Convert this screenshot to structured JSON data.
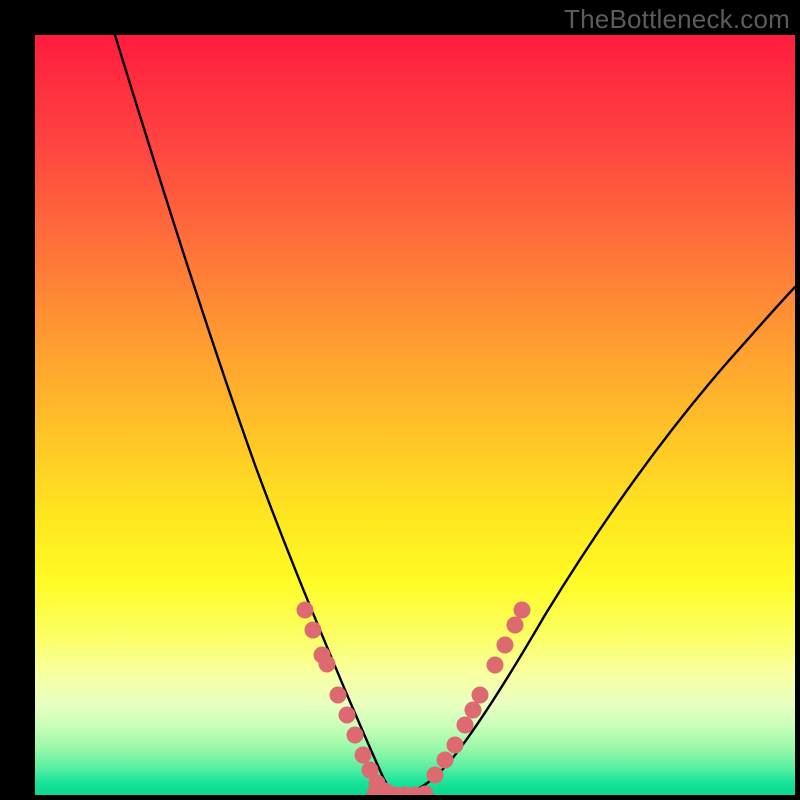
{
  "watermark": "TheBottleneck.com",
  "chart_data": {
    "type": "line",
    "title": "",
    "xlabel": "",
    "ylabel": "",
    "xlim": [
      0,
      100
    ],
    "ylim": [
      0,
      100
    ],
    "grid": false,
    "note": "Axes unlabeled; values are estimated pixel-relative percentages (0-100) read from the figure. Two thin black curves descend from the top edges toward a common minimum near x≈47 at the bottom, then rise. A red dotted overlay hugs the bottom of the V. Background is a vertical rainbow gradient from red (top) through yellow to green (bottom).",
    "series": [
      {
        "name": "left-curve",
        "color": "#000000",
        "x": [
          10.5,
          14.5,
          18.4,
          22.4,
          26.3,
          30.3,
          33.6,
          36.2,
          38.8,
          40.8,
          42.4,
          43.8,
          44.9,
          46.2,
          47.4
        ],
        "y": [
          100.0,
          87.5,
          75.0,
          62.5,
          50.0,
          38.2,
          28.9,
          22.4,
          15.8,
          10.5,
          6.6,
          3.9,
          1.6,
          0.3,
          0.0
        ]
      },
      {
        "name": "right-curve",
        "color": "#000000",
        "x": [
          47.4,
          48.7,
          50.0,
          51.3,
          52.6,
          54.6,
          56.6,
          59.2,
          62.5,
          65.8,
          71.1,
          76.3,
          81.6,
          88.2,
          94.7,
          100.0
        ],
        "y": [
          0.0,
          0.3,
          0.5,
          1.1,
          2.0,
          3.9,
          6.6,
          10.5,
          15.8,
          21.1,
          28.9,
          36.8,
          43.4,
          51.3,
          57.9,
          63.2
        ]
      },
      {
        "name": "dots-left",
        "color": "#de6a71",
        "style": "markers",
        "x": [
          35.5,
          36.6,
          37.8,
          38.4,
          39.9,
          41.1,
          42.1,
          43.2,
          44.1,
          45.0,
          46.1
        ],
        "y": [
          24.3,
          21.7,
          18.4,
          17.2,
          13.2,
          10.5,
          7.9,
          5.3,
          3.3,
          1.6,
          0.5
        ]
      },
      {
        "name": "dots-base",
        "color": "#de6a71",
        "style": "markers",
        "x": [
          44.7,
          46.1,
          47.4,
          48.7,
          50.0,
          51.3
        ],
        "y": [
          0.0,
          0.0,
          0.0,
          0.0,
          0.0,
          0.0
        ]
      },
      {
        "name": "dots-right",
        "color": "#de6a71",
        "style": "markers",
        "x": [
          52.6,
          53.9,
          55.3,
          56.6,
          57.6,
          58.6,
          60.5,
          61.8,
          63.2,
          64.1
        ],
        "y": [
          2.6,
          4.6,
          6.6,
          9.2,
          11.2,
          13.2,
          17.1,
          19.7,
          22.4,
          24.3
        ]
      }
    ],
    "gradient_stops": [
      {
        "pos": 0,
        "color": "#ff1c40"
      },
      {
        "pos": 6,
        "color": "#ff2d3f"
      },
      {
        "pos": 14,
        "color": "#ff4340"
      },
      {
        "pos": 26,
        "color": "#ff6b3b"
      },
      {
        "pos": 38,
        "color": "#ff9433"
      },
      {
        "pos": 52,
        "color": "#ffc228"
      },
      {
        "pos": 64,
        "color": "#ffe81f"
      },
      {
        "pos": 72,
        "color": "#fffb25"
      },
      {
        "pos": 79,
        "color": "#fcff63"
      },
      {
        "pos": 84,
        "color": "#f8ffa0"
      },
      {
        "pos": 88,
        "color": "#e8ffbf"
      },
      {
        "pos": 91,
        "color": "#c8ffb8"
      },
      {
        "pos": 94,
        "color": "#96f7a8"
      },
      {
        "pos": 96.5,
        "color": "#57eea2"
      },
      {
        "pos": 98,
        "color": "#22e69c"
      },
      {
        "pos": 99,
        "color": "#11dd95"
      },
      {
        "pos": 100,
        "color": "#0cd891"
      }
    ]
  }
}
